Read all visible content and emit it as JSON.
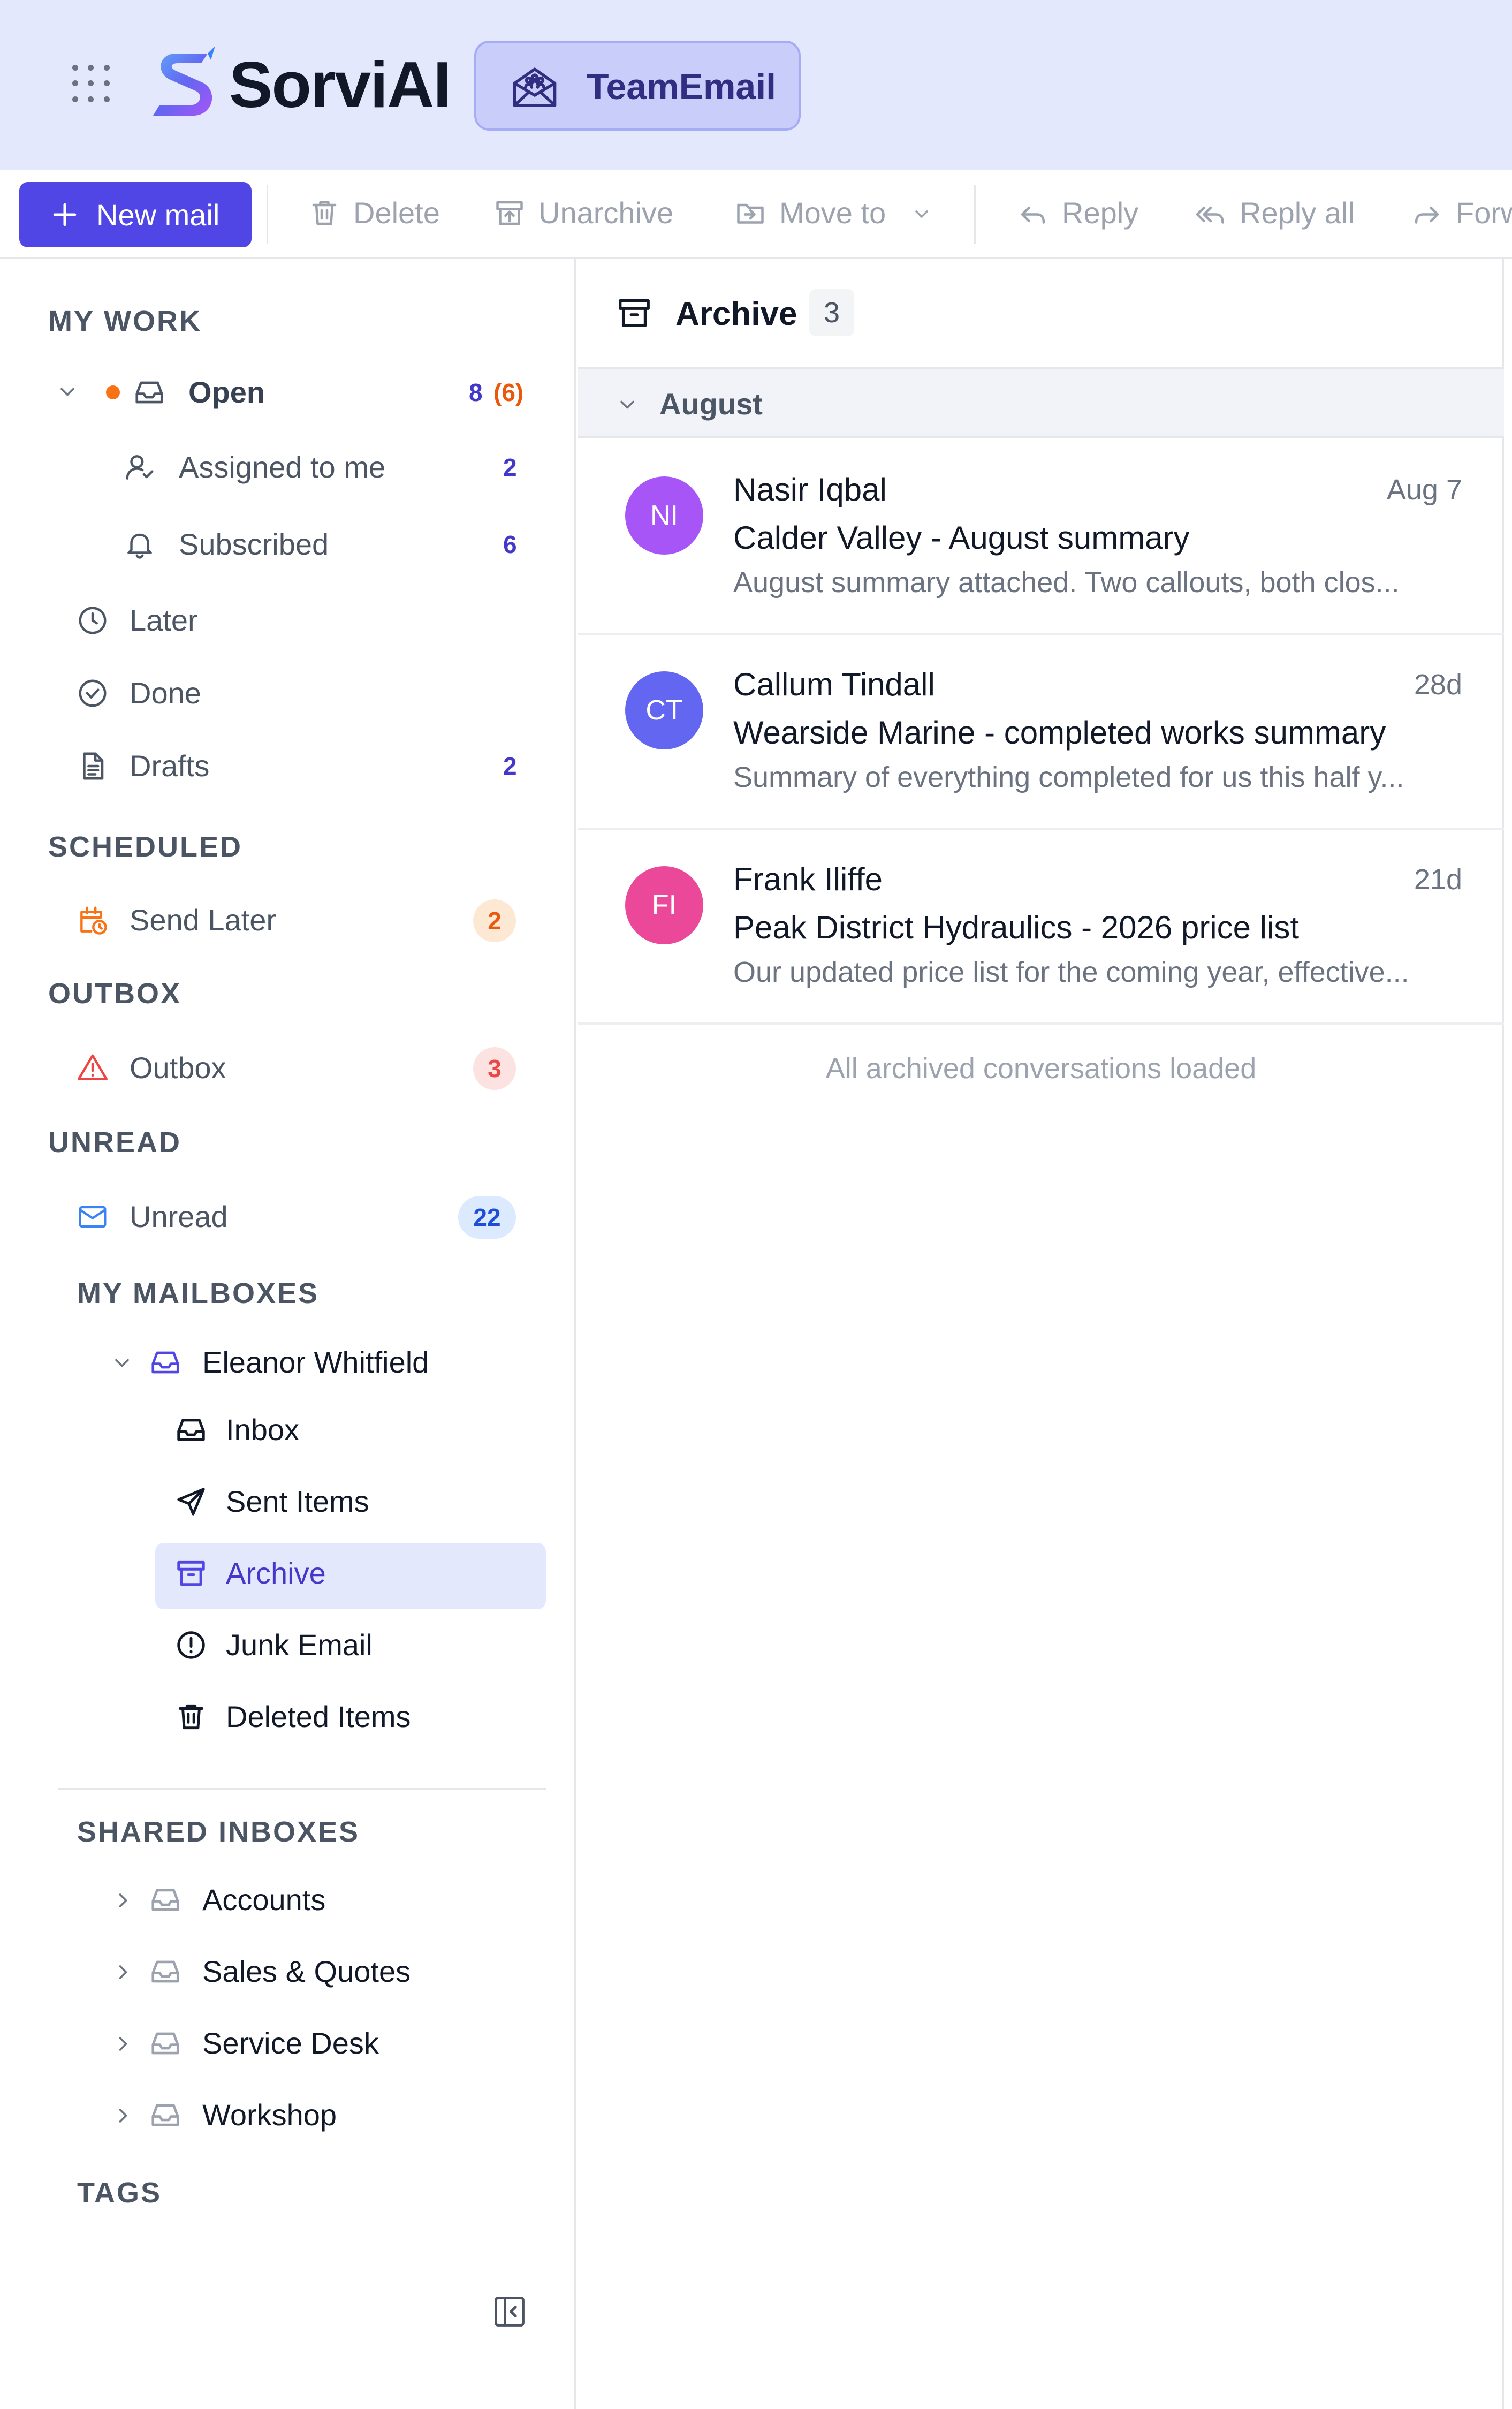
{
  "topbar": {
    "brand": "SorviAI",
    "app_badge": "TeamEmail"
  },
  "toolbar": {
    "new_mail": "New mail",
    "delete": "Delete",
    "unarchive": "Unarchive",
    "move_to": "Move to",
    "reply": "Reply",
    "reply_all": "Reply all",
    "forward": "Forw"
  },
  "sidebar": {
    "my_work": {
      "heading": "MY WORK",
      "open": {
        "label": "Open",
        "count": "8",
        "count_secondary": "(6)"
      },
      "assigned": {
        "label": "Assigned to me",
        "count": "2"
      },
      "subscribed": {
        "label": "Subscribed",
        "count": "6"
      },
      "later": {
        "label": "Later"
      },
      "done": {
        "label": "Done"
      },
      "drafts": {
        "label": "Drafts",
        "count": "2"
      }
    },
    "scheduled": {
      "heading": "SCHEDULED",
      "send_later": {
        "label": "Send Later",
        "count": "2"
      }
    },
    "outbox": {
      "heading": "OUTBOX",
      "outbox": {
        "label": "Outbox",
        "count": "3"
      }
    },
    "unread": {
      "heading": "UNREAD",
      "unread": {
        "label": "Unread",
        "count": "22"
      }
    },
    "my_mailboxes": {
      "heading": "MY MAILBOXES",
      "owner": "Eleanor Whitfield",
      "folders": [
        "Inbox",
        "Sent Items",
        "Archive",
        "Junk Email",
        "Deleted Items"
      ]
    },
    "shared_inboxes": {
      "heading": "SHARED INBOXES",
      "items": [
        "Accounts",
        "Sales & Quotes",
        "Service Desk",
        "Workshop"
      ]
    },
    "tags": {
      "heading": "TAGS"
    }
  },
  "colors": {
    "accent": "#4f46e5",
    "topbar_bg": "#e4e8fd",
    "warning": "#f97316",
    "danger": "#ef4444",
    "info": "#3b82f6"
  },
  "list": {
    "title": "Archive",
    "count": "3",
    "group": "August",
    "messages": [
      {
        "initials": "NI",
        "avatar_color": "#a855f7",
        "sender": "Nasir Iqbal",
        "date": "Aug 7",
        "subject": "Calder Valley - August summary",
        "preview": "August summary attached. Two callouts, both clos..."
      },
      {
        "initials": "CT",
        "avatar_color": "#6366f1",
        "sender": "Callum Tindall",
        "date": "28d",
        "subject": "Wearside Marine - completed works summary",
        "preview": "Summary of everything completed for us this half y..."
      },
      {
        "initials": "FI",
        "avatar_color": "#ec4899",
        "sender": "Frank Iliffe",
        "date": "21d",
        "subject": "Peak District Hydraulics - 2026 price list",
        "preview": "Our updated price list for the coming year, effective..."
      }
    ],
    "footer": "All archived conversations loaded"
  }
}
